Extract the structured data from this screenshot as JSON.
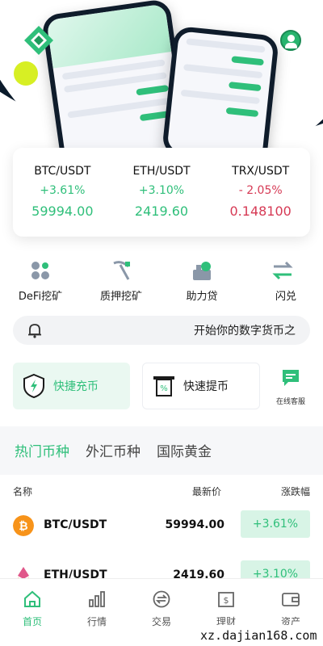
{
  "tickers": [
    {
      "pair": "BTC/USDT",
      "change": "+3.61%",
      "price": "59994.00",
      "trend": "up"
    },
    {
      "pair": "ETH/USDT",
      "change": "+3.10%",
      "price": "2419.60",
      "trend": "up"
    },
    {
      "pair": "TRX/USDT",
      "change": "- 2.05%",
      "price": "0.148100",
      "trend": "down"
    }
  ],
  "quick_actions": [
    {
      "label": "DeFi挖矿",
      "icon": "defi-icon"
    },
    {
      "label": "质押挖矿",
      "icon": "pickaxe-icon"
    },
    {
      "label": "助力贷",
      "icon": "loan-icon"
    },
    {
      "label": "闪兑",
      "icon": "swap-icon"
    }
  ],
  "notice": {
    "text": "开始你的数字货币之"
  },
  "buttons": {
    "deposit": "快捷充币",
    "withdraw": "快速提币",
    "service": "在线客服"
  },
  "market": {
    "tabs": [
      "热门币种",
      "外汇币种",
      "国际黄金"
    ],
    "active_tab": 0,
    "headers": {
      "name": "名称",
      "last": "最新价",
      "change": "涨跌幅"
    },
    "rows": [
      {
        "symbol": "BTC/USDT",
        "last": "59994.00",
        "change": "+3.61%"
      },
      {
        "symbol": "ETH/USDT",
        "last": "2419.60",
        "change": "+3.10%"
      }
    ]
  },
  "bottom_nav": [
    {
      "label": "首页",
      "icon": "home-icon",
      "active": true
    },
    {
      "label": "行情",
      "icon": "chart-icon",
      "active": false
    },
    {
      "label": "交易",
      "icon": "exchange-icon",
      "active": false
    },
    {
      "label": "理财",
      "icon": "finance-icon",
      "active": false
    },
    {
      "label": "资产",
      "icon": "wallet-icon",
      "active": false
    }
  ],
  "watermark": "xz.dajian168.com",
  "colors": {
    "accent": "#2fbf7a",
    "down": "#d63a55",
    "dark": "#0b1b2b"
  }
}
